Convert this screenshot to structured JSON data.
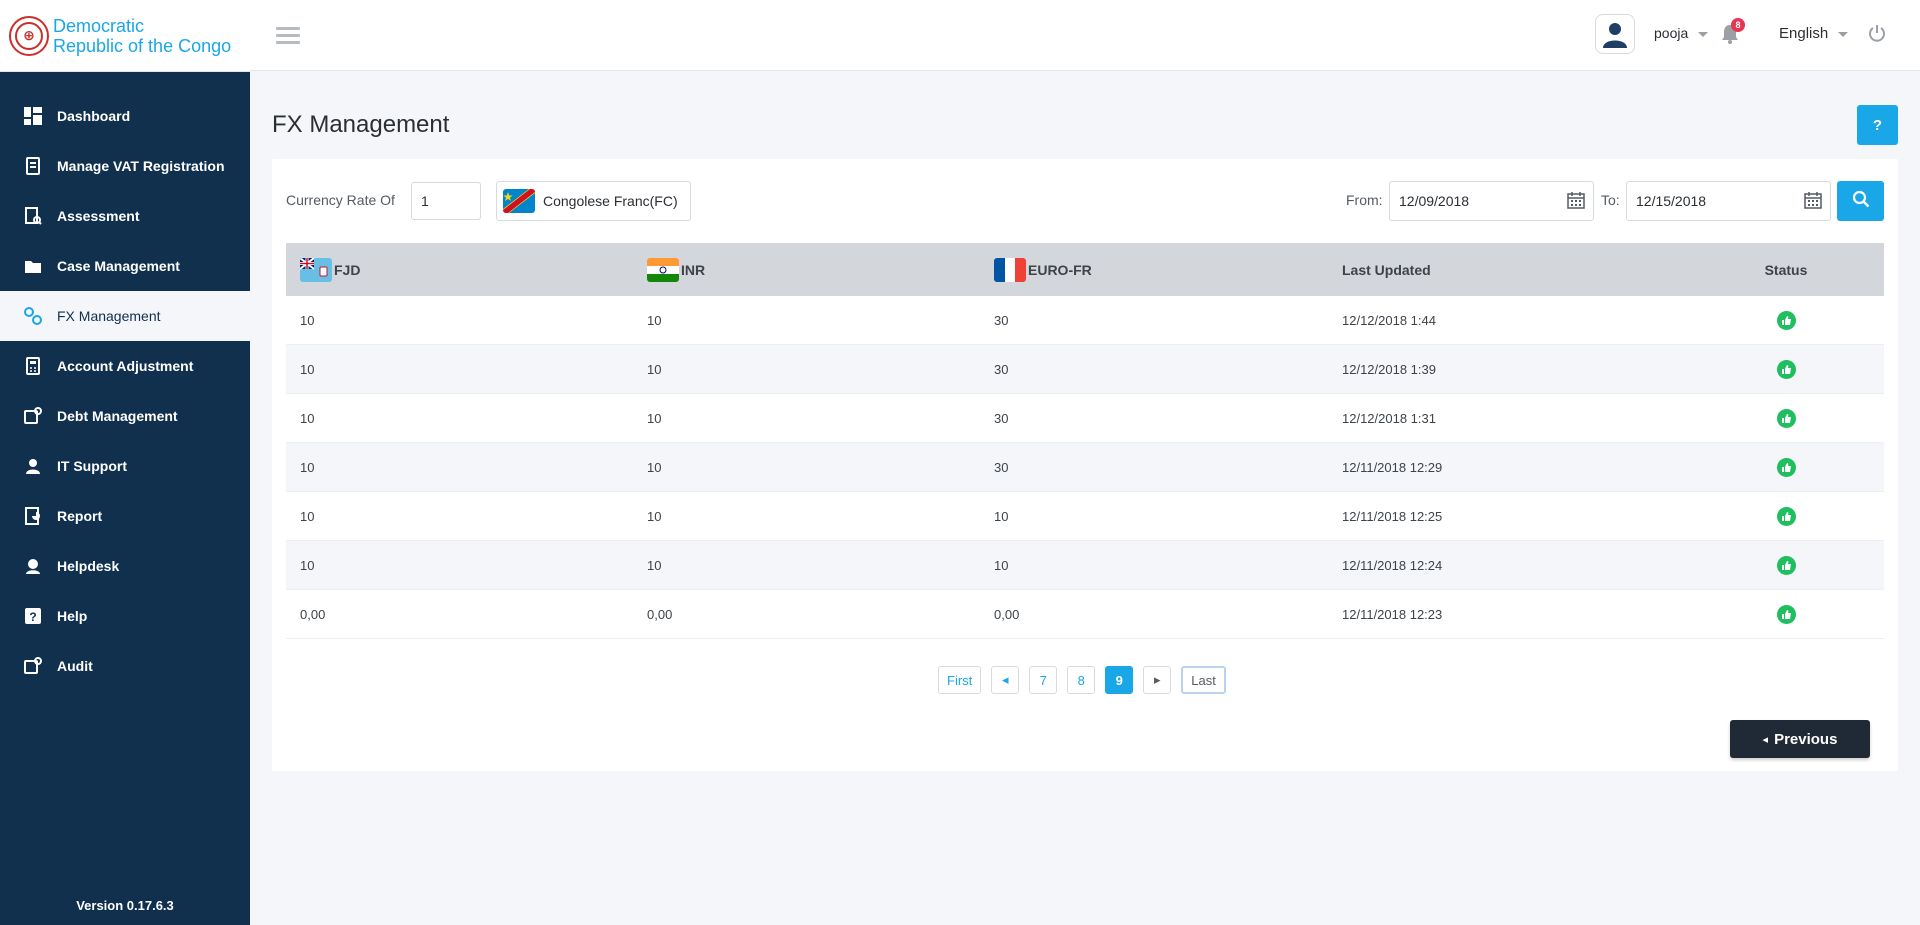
{
  "brand": {
    "line1": "Democratic",
    "line2": "Republic of the Congo"
  },
  "sidebar": {
    "items": [
      {
        "label": "Dashboard",
        "icon": "dashboard-icon"
      },
      {
        "label": "Manage VAT Registration",
        "icon": "vat-registration-icon"
      },
      {
        "label": "Assessment",
        "icon": "assessment-icon"
      },
      {
        "label": "Case Management",
        "icon": "case-management-icon"
      },
      {
        "label": "FX Management",
        "icon": "fx-management-icon",
        "active": true
      },
      {
        "label": "Account Adjustment",
        "icon": "account-adjustment-icon"
      },
      {
        "label": "Debt Management",
        "icon": "debt-management-icon"
      },
      {
        "label": "IT Support",
        "icon": "it-support-icon"
      },
      {
        "label": "Report",
        "icon": "report-icon"
      },
      {
        "label": "Helpdesk",
        "icon": "helpdesk-icon"
      },
      {
        "label": "Help",
        "icon": "help-icon"
      },
      {
        "label": "Audit",
        "icon": "audit-icon"
      }
    ],
    "version": "Version 0.17.6.3"
  },
  "header": {
    "username": "pooja",
    "notification_count": "8",
    "language": "English"
  },
  "page": {
    "title": "FX Management",
    "help_label": "?"
  },
  "filters": {
    "currency_rate_label": "Currency Rate Of",
    "amount": "1",
    "currency": "Congolese Franc(FC)",
    "from_label": "From:",
    "from_date": "12/09/2018",
    "to_label": "To:",
    "to_date": "12/15/2018"
  },
  "table": {
    "headers": {
      "fjd": "FJD",
      "inr": "INR",
      "euro": "EURO-FR",
      "updated": "Last Updated",
      "status": "Status"
    },
    "rows": [
      {
        "fjd": "10",
        "inr": "10",
        "euro": "30",
        "updated": "12/12/2018 1:44"
      },
      {
        "fjd": "10",
        "inr": "10",
        "euro": "30",
        "updated": "12/12/2018 1:39"
      },
      {
        "fjd": "10",
        "inr": "10",
        "euro": "30",
        "updated": "12/12/2018 1:31"
      },
      {
        "fjd": "10",
        "inr": "10",
        "euro": "30",
        "updated": "12/11/2018 12:29"
      },
      {
        "fjd": "10",
        "inr": "10",
        "euro": "10",
        "updated": "12/11/2018 12:25"
      },
      {
        "fjd": "10",
        "inr": "10",
        "euro": "10",
        "updated": "12/11/2018 12:24"
      },
      {
        "fjd": "0,00",
        "inr": "0,00",
        "euro": "0,00",
        "updated": "12/11/2018 12:23"
      }
    ]
  },
  "pagination": {
    "first": "First",
    "pages": [
      "7",
      "8",
      "9"
    ],
    "current": "9",
    "last": "Last"
  },
  "actions": {
    "previous": "Previous"
  },
  "colors": {
    "sidebar": "#10304e",
    "accent": "#1aa7e8",
    "status_ok": "#1fbf5f",
    "badge": "#e8344e"
  }
}
